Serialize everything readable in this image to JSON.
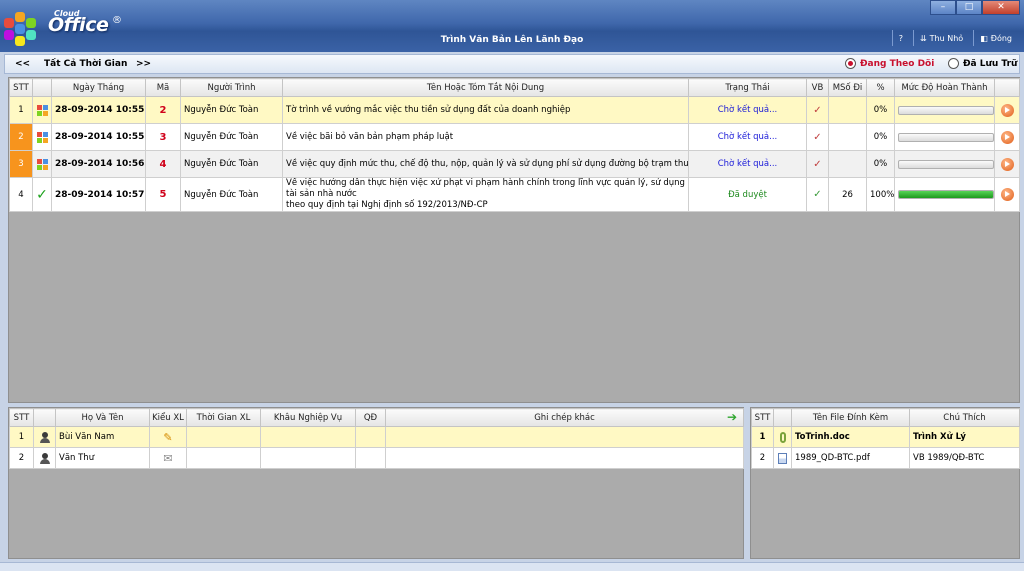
{
  "app": {
    "logo_small": "Cloud",
    "logo_big": "Office",
    "logo_reg": "®",
    "window_title": "Trình Văn Bản Lên Lãnh Đạo"
  },
  "window_controls": {
    "minimize": "–",
    "maximize": "□",
    "close": "✕"
  },
  "top_buttons": [
    {
      "icon": "help-icon",
      "glyph": "?",
      "label": ""
    },
    {
      "icon": "collapse-icon",
      "glyph": "⇊",
      "label": "Thu Nhỏ"
    },
    {
      "icon": "exit-icon",
      "glyph": "◧",
      "label": "Đóng"
    }
  ],
  "filter": {
    "prev": "<<",
    "period": "Tất Cả Thời Gian",
    "next": ">>",
    "radio_following": "Đang Theo Dõi",
    "radio_archived": "Đã Lưu Trữ",
    "selected": "following"
  },
  "main": {
    "columns": [
      "STT",
      "",
      "Ngày Tháng",
      "Mã",
      "Người Trình",
      "Tên Hoặc Tóm Tắt Nội Dung",
      "Trạng Thái",
      "VB",
      "MSố Đi",
      "%",
      "Mức Độ Hoàn Thành",
      ""
    ],
    "rows": [
      {
        "stt": "1",
        "icon": "app-grid-icon",
        "date": "28-09-2014 10:55",
        "ma": "2",
        "submitter": "Nguyễn Đức Toàn",
        "content": "Tờ trình về vướng mắc việc thu tiền sử dụng đất của doanh nghiệp",
        "content2": "",
        "status": "Chờ kết quả...",
        "vb": "✓",
        "out_no": "",
        "percent": "0%",
        "progress": 0
      },
      {
        "stt": "2",
        "icon": "app-grid-icon",
        "date": "28-09-2014 10:55",
        "ma": "3",
        "submitter": "Nguyễn Đức Toàn",
        "content": "Về việc bãi bỏ văn bản phạm pháp luật",
        "content2": "",
        "status": "Chờ kết quả...",
        "vb": "✓",
        "out_no": "",
        "percent": "0%",
        "progress": 0
      },
      {
        "stt": "3",
        "icon": "app-grid-icon",
        "date": "28-09-2014 10:56",
        "ma": "4",
        "submitter": "Nguyễn Đức Toàn",
        "content": "Về việc quy định mức thu, chế độ thu, nộp, quản lý và sử dụng phí sử dụng đường bộ trạm thu phí cầu Bến Thủy",
        "content2": "",
        "status": "Chờ kết quả...",
        "vb": "✓",
        "out_no": "",
        "percent": "0%",
        "progress": 0
      },
      {
        "stt": "4",
        "icon": "check-icon",
        "date": "28-09-2014 10:57",
        "ma": "5",
        "submitter": "Nguyễn Đức Toàn",
        "content": "Về việc hướng dẫn thực hiện việc xử phạt vi phạm hành chính trong lĩnh vực quản lý, sử dụng tài sản nhà nước",
        "content2": "theo quy định tại Nghị định số 192/2013/NĐ-CP",
        "status": "Đã duyệt",
        "vb": "✓",
        "out_no": "26",
        "percent": "100%",
        "progress": 1
      }
    ]
  },
  "handlers": {
    "columns": [
      "STT",
      "",
      "Họ Và Tên",
      "Kiểu XL",
      "Thời Gian XL",
      "Khâu Nghiệp Vụ",
      "QĐ",
      "Ghi chép khác"
    ],
    "rows": [
      {
        "stt": "1",
        "name": "Bùi Văn Nam",
        "type_icon": "pencil-icon",
        "type_glyph": "✎",
        "time": "",
        "stage": "",
        "qd": "",
        "note": ""
      },
      {
        "stt": "2",
        "name": "Văn Thư",
        "type_icon": "envelope-icon",
        "type_glyph": "✉",
        "time": "",
        "stage": "",
        "qd": "",
        "note": ""
      }
    ]
  },
  "attachments": {
    "columns": [
      "STT",
      "",
      "Tên File Đính Kèm",
      "Chú Thích"
    ],
    "rows": [
      {
        "stt": "1",
        "icon": "paperclip-icon",
        "glyph": "📎",
        "file": "ToTrinh.doc",
        "note": "Trình Xử Lý"
      },
      {
        "stt": "2",
        "icon": "pdf-icon",
        "glyph": "▤",
        "file": "1989_QD-BTC.pdf",
        "note": "VB 1989/QĐ-BTC"
      }
    ]
  }
}
